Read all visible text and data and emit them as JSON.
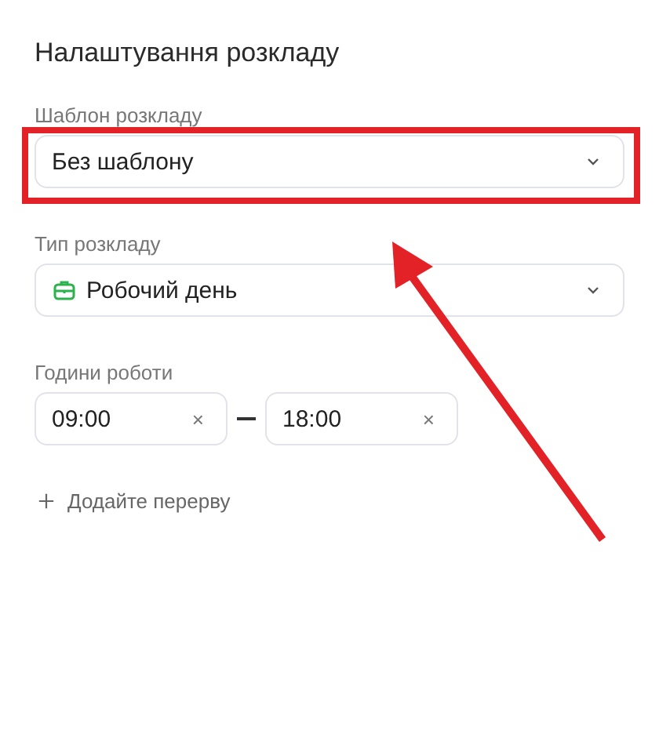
{
  "title": "Налаштування розкладу",
  "fields": [
    {
      "kind": "select",
      "label": "Шаблон розкладу",
      "value": "Без шаблону",
      "icon": false
    },
    {
      "kind": "select",
      "label": "Тип розкладу",
      "value": "Робочий день",
      "icon": true
    },
    {
      "kind": "time-range",
      "label": "Години роботи",
      "start": "09:00",
      "end": "18:00",
      "clear": "×"
    }
  ],
  "add_break": "Додайте перерву",
  "annotation": {
    "highlight_box": true,
    "arrow": true
  }
}
